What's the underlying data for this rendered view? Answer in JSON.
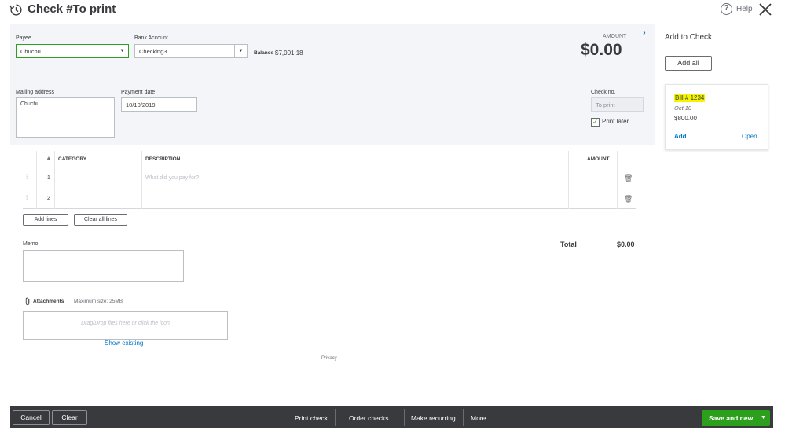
{
  "header": {
    "title": "Check #To print",
    "help_label": "Help"
  },
  "form": {
    "payee_label": "Payee",
    "payee_value": "Chuchu",
    "bank_label": "Bank Account",
    "bank_value": "Checking3",
    "balance_label": "Balance",
    "balance_value": "$7,001.18",
    "amount_label": "AMOUNT",
    "amount_value": "$0.00",
    "mailing_label": "Mailing address",
    "mailing_value": "Chuchu",
    "date_label": "Payment date",
    "date_value": "10/10/2019",
    "checkno_label": "Check no.",
    "checkno_value": "To print",
    "print_later_label": "Print later",
    "print_later_checked": true
  },
  "table": {
    "headers": {
      "num": "#",
      "category": "CATEGORY",
      "description": "DESCRIPTION",
      "amount": "AMOUNT"
    },
    "rows": [
      {
        "num": "1",
        "category": "",
        "description_placeholder": "What did you pay for?",
        "amount": ""
      },
      {
        "num": "2",
        "category": "",
        "description_placeholder": "",
        "amount": ""
      }
    ],
    "add_lines_label": "Add lines",
    "clear_lines_label": "Clear all lines"
  },
  "memo": {
    "label": "Memo",
    "value": ""
  },
  "total": {
    "label": "Total",
    "value": "$0.00"
  },
  "attachments": {
    "label": "Attachments",
    "max_size": "Maximum size: 25MB",
    "drop_text": "Drag/Drop files here or click the icon",
    "show_existing": "Show existing"
  },
  "privacy": "Privacy",
  "panel": {
    "title": "Add to Check",
    "add_all_label": "Add all",
    "bill": {
      "title": "Bill # 1234",
      "date": "Oct 10",
      "amount": "$800.00",
      "add_label": "Add",
      "open_label": "Open"
    }
  },
  "footer": {
    "cancel": "Cancel",
    "clear": "Clear",
    "print_check": "Print check",
    "order_checks": "Order checks",
    "make_recurring": "Make recurring",
    "more": "More",
    "save_and_new": "Save and new"
  },
  "colors": {
    "accent_green": "#2ca01c",
    "link_blue": "#0077c5",
    "footer_bg": "#393a3d",
    "highlight": "#f5f500"
  }
}
